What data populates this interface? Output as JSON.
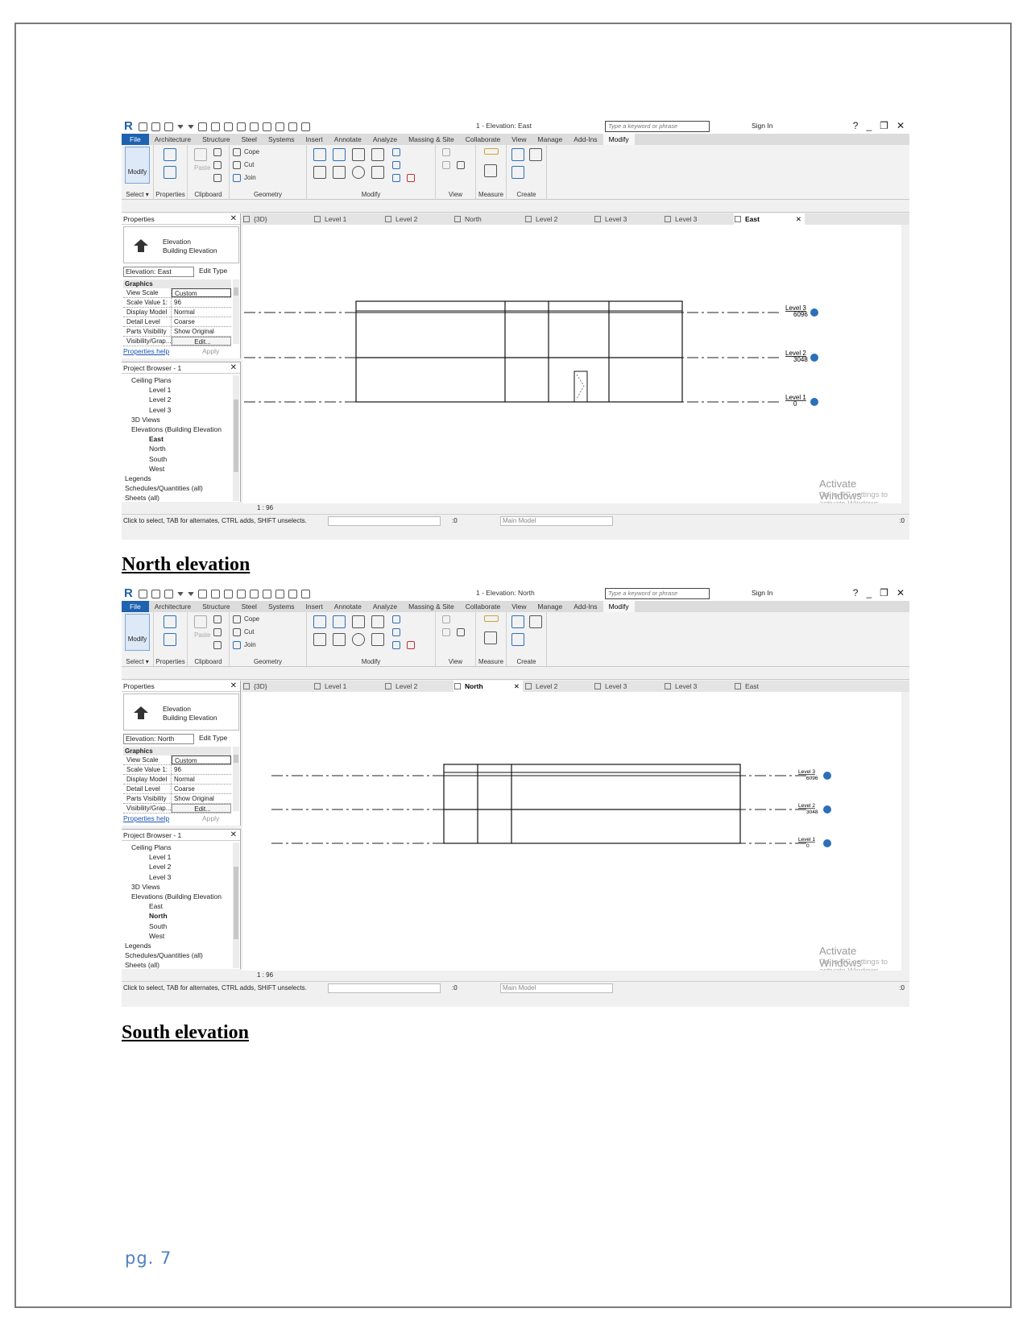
{
  "page": {
    "number": "pg. 7"
  },
  "headings": {
    "north": "North elevation",
    "south": "South elevation"
  },
  "screenshots": [
    {
      "window_title": "1 - Elevation: East",
      "search_placeholder": "Type a keyword or phrase",
      "sign_in": "Sign In",
      "ribbon_tabs": [
        "File",
        "Architecture",
        "Structure",
        "Steel",
        "Systems",
        "Insert",
        "Annotate",
        "Analyze",
        "Massing & Site",
        "Collaborate",
        "View",
        "Manage",
        "Add-Ins",
        "Modify"
      ],
      "active_ribbon_tab": "Modify",
      "ribbon_panels": {
        "select": "Select ▾",
        "properties": "Properties",
        "clipboard": "Clipboard",
        "geometry": "Geometry",
        "modify": "Modify",
        "view": "View",
        "measure": "Measure",
        "create": "Create",
        "modify_btn": "Modify",
        "paste": "Paste",
        "cope": "Cope",
        "cut": "Cut",
        "join": "Join"
      },
      "properties": {
        "title": "Properties",
        "type_name": "Elevation",
        "type_sub": "Building Elevation",
        "instance": "Elevation: East",
        "edit_type": "Edit Type",
        "group": "Graphics",
        "rows": [
          {
            "key": "View Scale",
            "value": "Custom"
          },
          {
            "key": "Scale Value    1:",
            "value": "96"
          },
          {
            "key": "Display Model",
            "value": "Normal"
          },
          {
            "key": "Detail Level",
            "value": "Coarse"
          },
          {
            "key": "Parts Visibility",
            "value": "Show Original"
          },
          {
            "key": "Visibility/Grap...",
            "value": "Edit..."
          }
        ],
        "help": "Properties help",
        "apply": "Apply"
      },
      "browser": {
        "title": "Project Browser - 1",
        "items": [
          "Ceiling Plans",
          "Level 1",
          "Level 2",
          "Level 3",
          "3D Views",
          "Elevations (Building Elevation",
          "East",
          "North",
          "South",
          "West",
          "Legends",
          "Schedules/Quantities (all)",
          "Sheets (all)"
        ],
        "selected": "East"
      },
      "view_tabs": [
        "{3D}",
        "Level 1",
        "Level 2",
        "North",
        "Level 2",
        "Level 3",
        "Level 3",
        "East"
      ],
      "active_view_tab": "East",
      "levels": [
        {
          "name": "Level 3",
          "elevation": "6096"
        },
        {
          "name": "Level 2",
          "elevation": "3048"
        },
        {
          "name": "Level 1",
          "elevation": "0"
        }
      ],
      "scale": "1 : 96",
      "activate_title": "Activate Windows",
      "activate_sub": "Go to PC settings to activate Windows.",
      "status_msg": "Click to select, TAB for alternates, CTRL adds, SHIFT unselects.",
      "status_zero": ":0",
      "model": "Main Model",
      "filter": ":0"
    },
    {
      "window_title": "1 - Elevation: North",
      "search_placeholder": "Type a keyword or phrase",
      "sign_in": "Sign In",
      "ribbon_tabs": [
        "File",
        "Architecture",
        "Structure",
        "Steel",
        "Systems",
        "Insert",
        "Annotate",
        "Analyze",
        "Massing & Site",
        "Collaborate",
        "View",
        "Manage",
        "Add-Ins",
        "Modify"
      ],
      "active_ribbon_tab": "Modify",
      "ribbon_panels": {
        "select": "Select ▾",
        "properties": "Properties",
        "clipboard": "Clipboard",
        "geometry": "Geometry",
        "modify": "Modify",
        "view": "View",
        "measure": "Measure",
        "create": "Create",
        "modify_btn": "Modify",
        "paste": "Paste",
        "cope": "Cope",
        "cut": "Cut",
        "join": "Join"
      },
      "properties": {
        "title": "Properties",
        "type_name": "Elevation",
        "type_sub": "Building Elevation",
        "instance": "Elevation: North",
        "edit_type": "Edit Type",
        "group": "Graphics",
        "rows": [
          {
            "key": "View Scale",
            "value": "Custom"
          },
          {
            "key": "Scale Value    1:",
            "value": "96"
          },
          {
            "key": "Display Model",
            "value": "Normal"
          },
          {
            "key": "Detail Level",
            "value": "Coarse"
          },
          {
            "key": "Parts Visibility",
            "value": "Show Original"
          },
          {
            "key": "Visibility/Grap...",
            "value": "Edit..."
          }
        ],
        "help": "Properties help",
        "apply": "Apply"
      },
      "browser": {
        "title": "Project Browser - 1",
        "items": [
          "Ceiling Plans",
          "Level 1",
          "Level 2",
          "Level 3",
          "3D Views",
          "Elevations (Building Elevation",
          "East",
          "North",
          "South",
          "West",
          "Legends",
          "Schedules/Quantities (all)",
          "Sheets (all)"
        ],
        "selected": "North"
      },
      "view_tabs": [
        "{3D}",
        "Level 1",
        "Level 2",
        "North",
        "Level 2",
        "Level 3",
        "Level 3",
        "East"
      ],
      "active_view_tab": "North",
      "levels": [
        {
          "name": "Level 3",
          "elevation": "6096"
        },
        {
          "name": "Level 2",
          "elevation": "3048"
        },
        {
          "name": "Level 1",
          "elevation": "0"
        }
      ],
      "scale": "1 : 96",
      "activate_title": "Activate Windows",
      "activate_sub": "Go to PC settings to activate Windows.",
      "status_msg": "Click to select, TAB for alternates, CTRL adds, SHIFT unselects.",
      "status_zero": ":0",
      "model": "Main Model",
      "filter": ":0"
    }
  ],
  "colors": {
    "file_tab": "#1e62b0",
    "page_number": "#4f81bd",
    "level_marker": "#2b6fb8"
  }
}
